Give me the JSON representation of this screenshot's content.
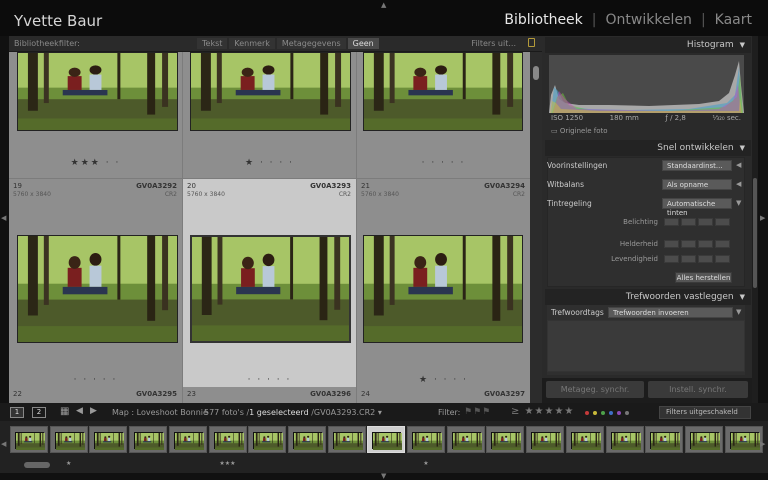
{
  "identity_plate": "Yvette Baur",
  "modules": [
    {
      "label": "Bibliotheek",
      "active": true
    },
    {
      "label": "Ontwikkelen",
      "active": false
    },
    {
      "label": "Kaart",
      "active": false
    }
  ],
  "filter_bar": {
    "label": "Bibliotheekfilter:",
    "options": [
      "Tekst",
      "Kenmerk",
      "Metagegevens",
      "Geen"
    ],
    "selected": "Geen",
    "filters_off": "Filters uit..."
  },
  "grid": {
    "top_row": [
      {
        "stars": "★★★ · ·"
      },
      {
        "stars": "★ · · · ·"
      },
      {
        "stars": "· · · · ·"
      }
    ],
    "mid_row": [
      {
        "num": "19",
        "dims": "5760 x 3840",
        "fname": "GV0A3292",
        "ext": "CR2",
        "stars": "· · · · ·",
        "selected": false
      },
      {
        "num": "20",
        "dims": "5760 x 3840",
        "fname": "GV0A3293",
        "ext": "CR2",
        "stars": "· · · · ·",
        "selected": true
      },
      {
        "num": "21",
        "dims": "5760 x 3840",
        "fname": "GV0A3294",
        "ext": "CR2",
        "stars": "★ · · · ·",
        "selected": false
      }
    ],
    "bottom_row": [
      {
        "num": "22",
        "fname": "GV0A3295"
      },
      {
        "num": "23",
        "fname": "GV0A3296"
      },
      {
        "num": "24",
        "fname": "GV0A3297"
      }
    ]
  },
  "histogram": {
    "title": "Histogram",
    "iso": "ISO 1250",
    "focal": "180 mm",
    "aperture": "ƒ / 2,8",
    "shutter": "¹⁄₃₂₀ sec.",
    "original": "Originele foto"
  },
  "quick_develop": {
    "title": "Snel ontwikkelen",
    "presets_label": "Voorinstellingen",
    "presets_value": "Standaardinst...",
    "wb_label": "Witbalans",
    "wb_value": "Als opname",
    "tone_label": "Tintregeling",
    "tone_value": "Automatische tinten",
    "exposure": "Belichting",
    "clarity": "Helderheid",
    "vibrance": "Levendigheid",
    "reset": "Alles herstellen"
  },
  "keywording": {
    "title": "Trefwoorden vastleggen",
    "tags_label": "Trefwoordtags",
    "tags_value": "Trefwoorden invoeren"
  },
  "sync": {
    "metadata": "Metageg. synchr.",
    "settings": "Instell. synchr."
  },
  "toolbar": {
    "page1": "1",
    "page2": "2",
    "source": "Map : Loveshoot Bonnie",
    "count_prefix": "577 foto's /",
    "count_selected": "1 geselecteerd",
    "count_suffix": "/GV0A3293.CR2 ▾",
    "filter_label": "Filter:",
    "stars": "≥ ★★★★★",
    "filters_select": "Filters uitgeschakeld"
  },
  "filmstrip": {
    "selected_index": 9,
    "stars": [
      "",
      "★",
      "",
      "",
      "",
      "★★★",
      "",
      "",
      "",
      "",
      "★",
      "",
      "",
      "",
      "",
      "",
      "",
      "",
      ""
    ]
  },
  "colors": {
    "red": "#c43a3a",
    "yellow": "#c8b93a",
    "green": "#4ea14a",
    "blue": "#3f6fc6",
    "purple": "#8d4bb6"
  }
}
